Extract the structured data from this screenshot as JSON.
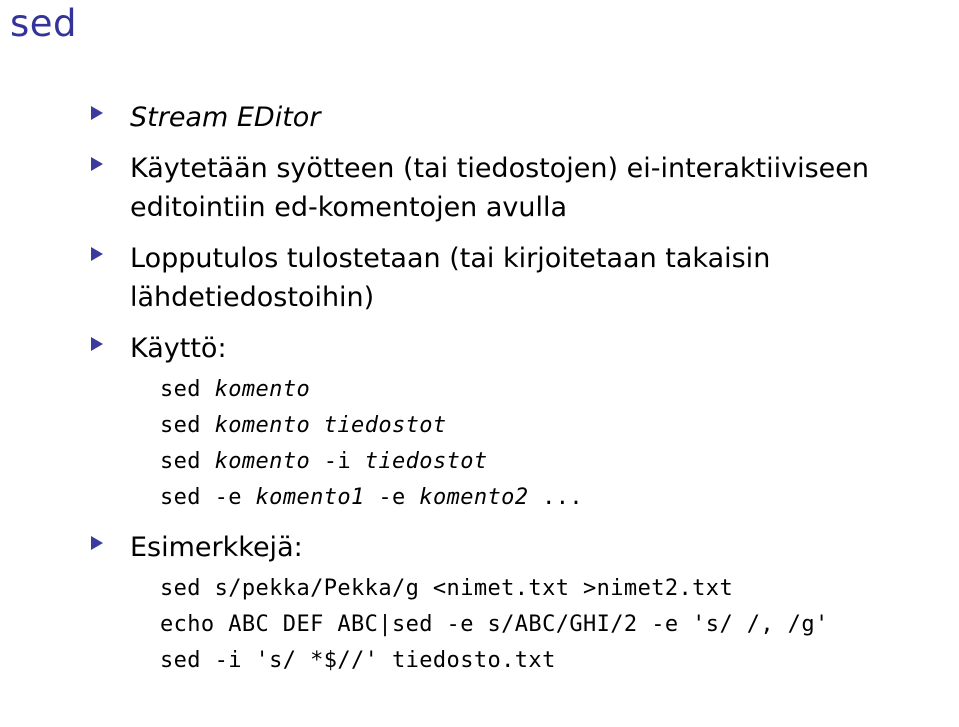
{
  "slide": {
    "title": "sed",
    "title_color": "#33339B",
    "bullet_color": "#3B3B9E",
    "background_color": "#FFFFFF",
    "text_color": "#000000"
  },
  "items": [
    {
      "id": "stream-editor",
      "text": "Stream EDitor",
      "style": "italic"
    },
    {
      "id": "kaytetaan",
      "text": "Käytetään syötteen (tai tiedostojen) ei-interaktiiviseen editointiin ed-komentojen avulla",
      "style": "normal"
    },
    {
      "id": "lopputulos",
      "text": "Lopputulos tulostetaan (tai kirjoitetaan takaisin lähdetiedostoihin)",
      "style": "normal"
    },
    {
      "id": "kaytto",
      "text": "Käyttö:",
      "style": "normal"
    },
    {
      "id": "esimerkkeja",
      "text": "Esimerkkejä:",
      "style": "normal"
    }
  ],
  "usage_code": {
    "lines": [
      {
        "plain1": "sed ",
        "emph1": "komento",
        "plain2": "",
        "emph2": "",
        "plain3": ""
      },
      {
        "plain1": "sed ",
        "emph1": "komento tiedostot",
        "plain2": "",
        "emph2": "",
        "plain3": ""
      },
      {
        "plain1": "sed ",
        "emph1": "komento",
        "plain2": " -i ",
        "emph2": "tiedostot",
        "plain3": ""
      },
      {
        "plain1": "sed -e ",
        "emph1": "komento1",
        "plain2": " -e ",
        "emph2": "komento2",
        "plain3": " ..."
      }
    ]
  },
  "example_code": {
    "lines": [
      "sed s/pekka/Pekka/g <nimet.txt >nimet2.txt",
      "echo ABC DEF ABC|sed -e s/ABC/GHI/2 -e 's/ /, /g'",
      "sed -i 's/ *$//' tiedosto.txt"
    ]
  }
}
